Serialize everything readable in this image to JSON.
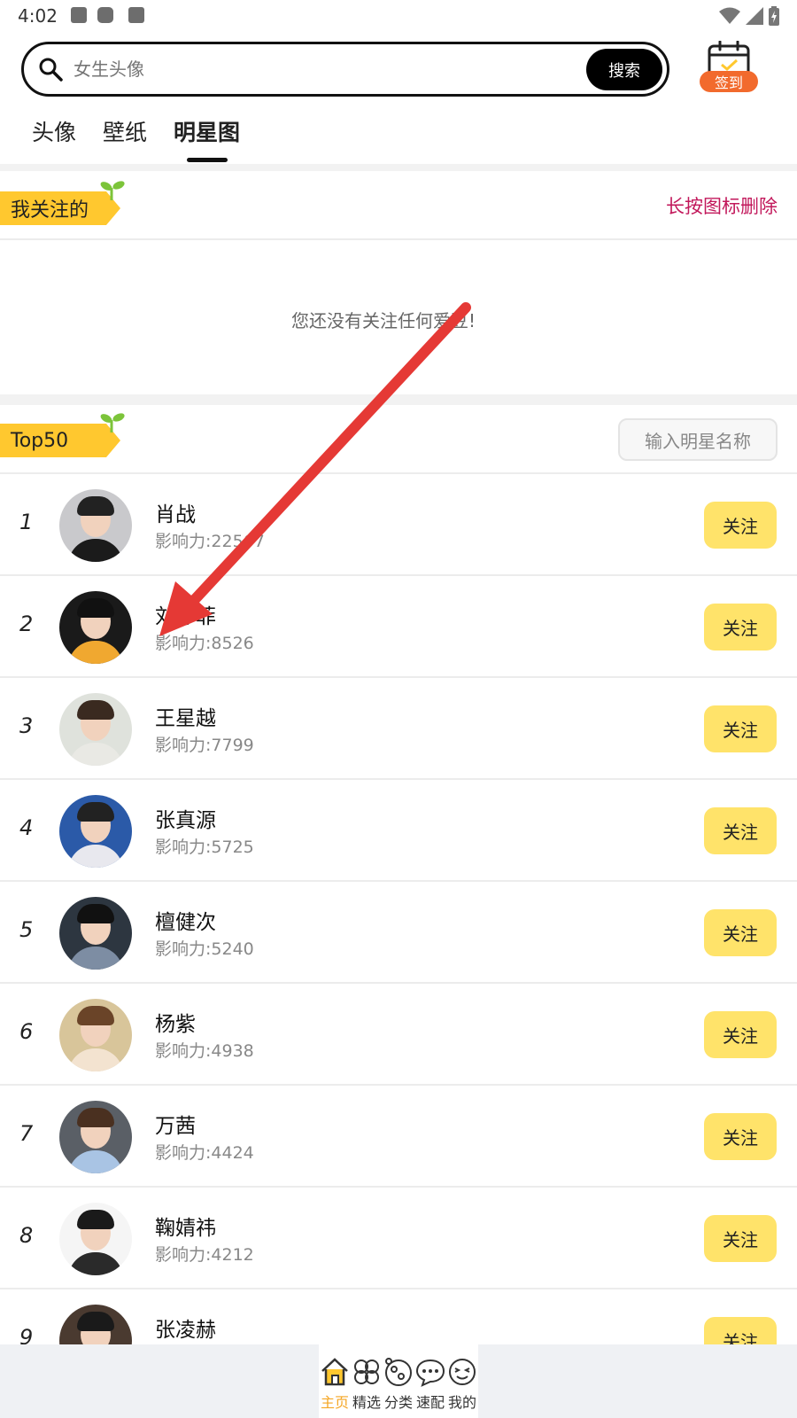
{
  "status_bar": {
    "time": "4:02"
  },
  "search": {
    "placeholder": "女生头像",
    "button_label": "搜索"
  },
  "signin": {
    "label": "签到"
  },
  "tabs": [
    {
      "label": "头像",
      "active": false
    },
    {
      "label": "壁纸",
      "active": false
    },
    {
      "label": "明星图",
      "active": true
    }
  ],
  "following": {
    "title": "我关注的",
    "hint": "长按图标删除",
    "empty_message": "您还没有关注任何爱豆!"
  },
  "top50": {
    "title": "Top50",
    "search_placeholder": "输入明星名称",
    "follow_label": "关注",
    "items": [
      {
        "rank": "1",
        "name": "肖战",
        "influence": "影响力:22567"
      },
      {
        "rank": "2",
        "name": "刘亦菲",
        "influence": "影响力:8526"
      },
      {
        "rank": "3",
        "name": "王星越",
        "influence": "影响力:7799"
      },
      {
        "rank": "4",
        "name": "张真源",
        "influence": "影响力:5725"
      },
      {
        "rank": "5",
        "name": "檀健次",
        "influence": "影响力:5240"
      },
      {
        "rank": "6",
        "name": "杨紫",
        "influence": "影响力:4938"
      },
      {
        "rank": "7",
        "name": "万茜",
        "influence": "影响力:4424"
      },
      {
        "rank": "8",
        "name": "鞠婧祎",
        "influence": "影响力:4212"
      },
      {
        "rank": "9",
        "name": "张凌赫",
        "influence": ""
      }
    ]
  },
  "bottom_nav": [
    {
      "label": "主页",
      "icon": "home-icon",
      "active": true
    },
    {
      "label": "精选",
      "icon": "flower-icon",
      "active": false
    },
    {
      "label": "分类",
      "icon": "categories-icon",
      "active": false
    },
    {
      "label": "速配",
      "icon": "chat-bubble-icon",
      "active": false
    },
    {
      "label": "我的",
      "icon": "smiley-icon",
      "active": false
    }
  ],
  "colors": {
    "accent_yellow": "#ffc82f",
    "follow_button": "#ffe36a",
    "hint_pink": "#c2185b",
    "signin_badge": "#f26a2d",
    "annotation_arrow": "#e53935"
  }
}
